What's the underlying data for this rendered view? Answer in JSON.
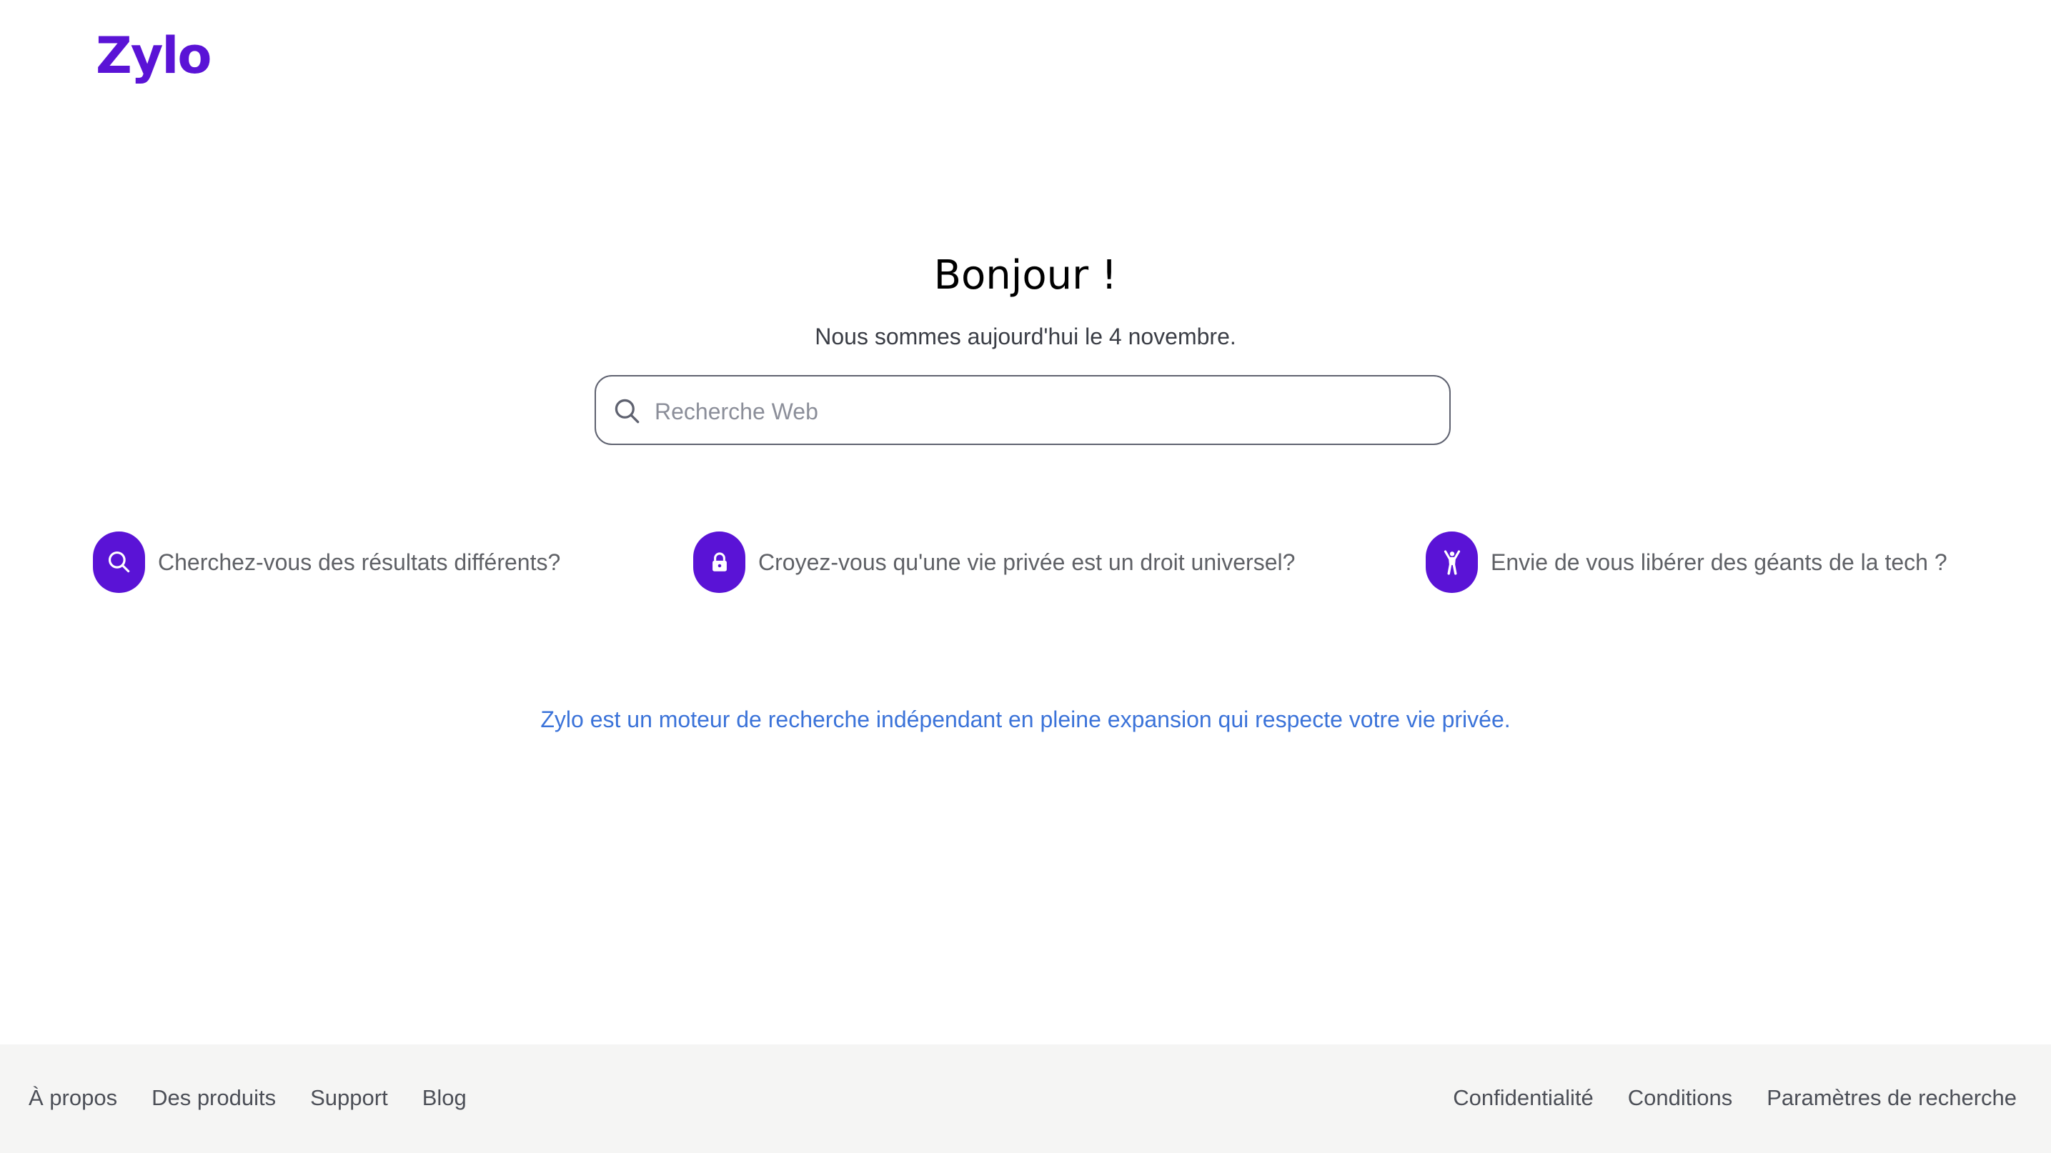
{
  "header": {
    "logo_text": "Zylo"
  },
  "hero": {
    "greeting": "Bonjour !",
    "date_line": "Nous sommes aujourd'hui le 4 novembre."
  },
  "search": {
    "placeholder": "Recherche Web",
    "value": "",
    "icon": "search-icon"
  },
  "promos": [
    {
      "icon": "search-icon",
      "text": "Cherchez-vous des résultats différents?"
    },
    {
      "icon": "lock-icon",
      "text": "Croyez-vous qu'une vie privée est un droit universel?"
    },
    {
      "icon": "person-raised-arms-icon",
      "text": "Envie de vous libérer des géants de la tech ?"
    }
  ],
  "tagline": "Zylo est un moteur de recherche indépendant en pleine expansion qui respecte votre vie privée.",
  "footer": {
    "left_links": [
      "À propos",
      "Des produits",
      "Support",
      "Blog"
    ],
    "right_links": [
      "Confidentialité",
      "Conditions",
      "Paramètres de recherche"
    ]
  },
  "colors": {
    "brand": "#5a13d6",
    "link": "#3b73d9",
    "footer_bg": "#f5f5f4"
  }
}
